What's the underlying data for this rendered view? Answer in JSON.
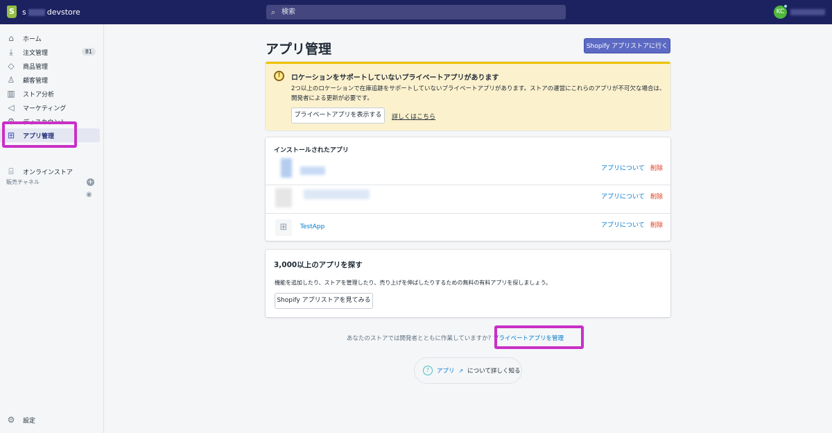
{
  "topbar": {
    "store_prefix": "s",
    "store_suffix": "devstore",
    "search_placeholder": "検索",
    "avatar_initials": "KC"
  },
  "sidebar": {
    "items": [
      {
        "label": "ホーム",
        "icon": "home-icon"
      },
      {
        "label": "注文管理",
        "icon": "orders-icon",
        "badge": "81"
      },
      {
        "label": "商品管理",
        "icon": "tag-icon"
      },
      {
        "label": "顧客管理",
        "icon": "person-icon"
      },
      {
        "label": "ストア分析",
        "icon": "chart-icon"
      },
      {
        "label": "マーケティング",
        "icon": "megaphone-icon"
      },
      {
        "label": "ディスカウント",
        "icon": "discount-icon"
      },
      {
        "label": "アプリ管理",
        "icon": "apps-icon"
      }
    ],
    "channels_label": "販売チャネル",
    "online_store": "オンラインストア",
    "settings": "設定"
  },
  "page": {
    "title": "アプリ管理",
    "visit_store_button": "Shopify アプリストアに行く"
  },
  "banner": {
    "title": "ロケーションをサポートしていないプライベートアプリがあります",
    "body": "2つ以上のロケーションで在庫追跡をサポートしていないプライベートアプリがあります。ストアの運営にこれらのアプリが不可欠な場合は、開発者による更新が必要です。",
    "show_button": "プライベートアプリを表示する",
    "learn_link": "詳しくはこちら"
  },
  "installed": {
    "title": "インストールされたアプリ",
    "apps": [
      {
        "name": "",
        "about": "アプリについて",
        "delete": "削除"
      },
      {
        "name": "",
        "about": "アプリについて",
        "delete": "削除"
      },
      {
        "name": "TestApp",
        "about": "アプリについて",
        "delete": "削除"
      }
    ]
  },
  "discover": {
    "title": "3,000以上のアプリを探す",
    "body": "機能を追加したり、ストアを管理したり、売り上げを伸ばしたりするための無料の有料アプリを探しましょう。",
    "button": "Shopify アプリストアを見てみる"
  },
  "footer": {
    "question": "あなたのストアでは開発者とともに作業していますか?",
    "manage_link": "プライベートアプリを管理",
    "learn_link": "アプリ",
    "learn_suffix": "について詳しく知る"
  }
}
